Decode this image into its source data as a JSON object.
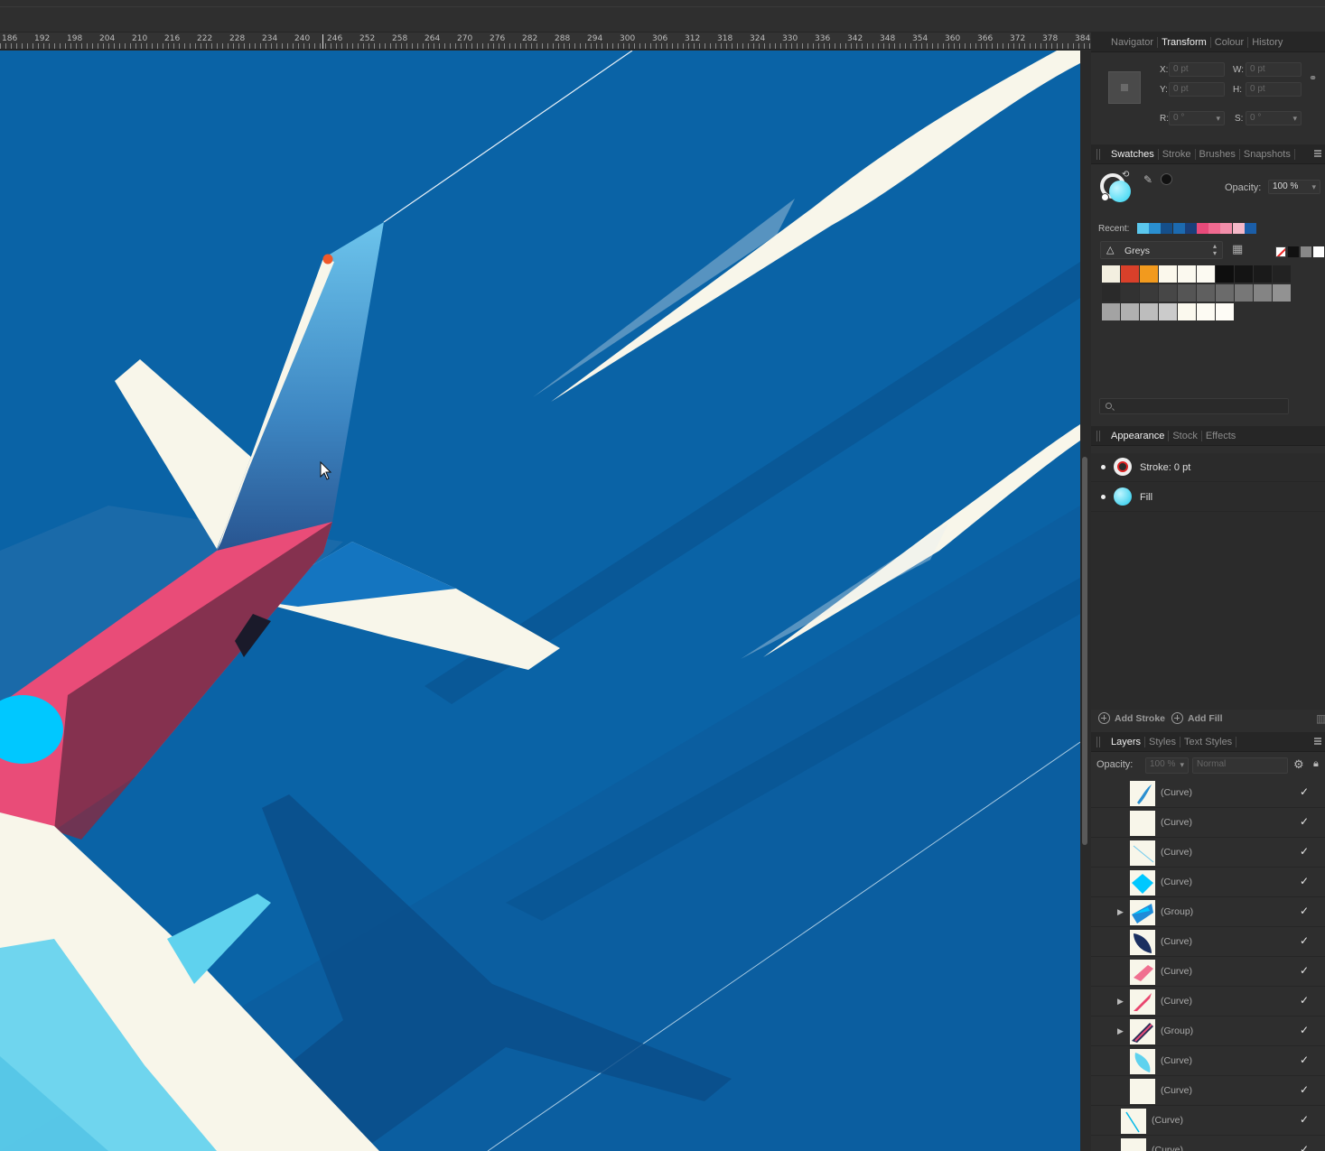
{
  "ruler": {
    "labels": [
      "186",
      "192",
      "198",
      "204",
      "210",
      "216",
      "222",
      "228",
      "234",
      "240",
      "246",
      "252",
      "258",
      "264",
      "270",
      "276",
      "282",
      "288",
      "294",
      "300",
      "306",
      "312",
      "318",
      "324",
      "330",
      "336",
      "342",
      "348",
      "354",
      "360",
      "366",
      "372",
      "378",
      "384"
    ]
  },
  "transform_panel": {
    "tabs": [
      "Navigator",
      "Transform",
      "Colour",
      "History"
    ],
    "active_tab": "Transform",
    "x_label": "X:",
    "x_value": "0 pt",
    "y_label": "Y:",
    "y_value": "0 pt",
    "w_label": "W:",
    "w_value": "0 pt",
    "h_label": "H:",
    "h_value": "0 pt",
    "r_label": "R:",
    "r_value": "0 °",
    "s_label": "S:",
    "s_value": "0 °",
    "link_icon": "link-icon"
  },
  "swatches_panel": {
    "tabs": [
      "Swatches",
      "Stroke",
      "Brushes",
      "Snapshots"
    ],
    "active_tab": "Swatches",
    "opacity_label": "Opacity:",
    "opacity_value": "100 %",
    "recent_label": "Recent:",
    "recent_colors": [
      "#5bc8ee",
      "#2a8fd0",
      "#154f8a",
      "#1c6ab0",
      "#1a3f7a",
      "#e84a7a",
      "#f06a90",
      "#f28eaa",
      "#f5b8c8",
      "#1b5ea8"
    ],
    "palette_name": "Greys",
    "palette_rows": [
      [
        "#f3efe0",
        "#d9402a",
        "#f29a1e",
        "#fbf8ec",
        "#fbf9ef",
        "#fcfaf2",
        "#0e0e0e",
        "#141414",
        "#1a1a1a",
        "#222222"
      ],
      [
        "#2a2a2a",
        "#323232",
        "#3a3a3a",
        "#474747",
        "#555555",
        "#5f5f5f",
        "#6b6b6b",
        "#777777",
        "#848484",
        "#929292"
      ],
      [
        "#a3a3a3",
        "#b0b0b0",
        "#bdbdbd",
        "#cbcbcb",
        "#fbf9ee",
        "#fdfbf3",
        "#fefcf6"
      ]
    ]
  },
  "appearance_panel": {
    "tabs": [
      "Appearance",
      "Stock",
      "Effects"
    ],
    "active_tab": "Appearance",
    "stroke_label": "Stroke: 0 pt",
    "fill_label": "Fill",
    "add_stroke": "Add Stroke",
    "add_fill": "Add Fill"
  },
  "layers_panel": {
    "tabs": [
      "Layers",
      "Styles",
      "Text Styles"
    ],
    "active_tab": "Layers",
    "opacity_label": "Opacity:",
    "opacity_value": "100 %",
    "blend_mode": "Normal",
    "rows": [
      {
        "name": "(Curve)",
        "thumb": "blue-stroke",
        "expand": false,
        "indent": 1
      },
      {
        "name": "(Curve)",
        "thumb": "cream",
        "expand": false,
        "indent": 1
      },
      {
        "name": "(Curve)",
        "thumb": "thin-line",
        "expand": false,
        "indent": 1
      },
      {
        "name": "(Curve)",
        "thumb": "cyan-diamond",
        "expand": false,
        "indent": 1
      },
      {
        "name": "(Group)",
        "thumb": "blue-wing",
        "expand": true,
        "indent": 1
      },
      {
        "name": "(Curve)",
        "thumb": "navy-leaf",
        "expand": false,
        "indent": 1
      },
      {
        "name": "(Curve)",
        "thumb": "pink-blob",
        "expand": false,
        "indent": 1
      },
      {
        "name": "(Curve)",
        "thumb": "pink-stroke",
        "expand": true,
        "indent": 1
      },
      {
        "name": "(Group)",
        "thumb": "navy-pink",
        "expand": true,
        "indent": 1
      },
      {
        "name": "(Curve)",
        "thumb": "cyan-leaf",
        "expand": false,
        "indent": 1
      },
      {
        "name": "(Curve)",
        "thumb": "cream",
        "expand": false,
        "indent": 1
      },
      {
        "name": "(Curve)",
        "thumb": "cyan-line",
        "expand": false,
        "indent": 0
      },
      {
        "name": "(Curve)",
        "thumb": "cream",
        "expand": false,
        "indent": 0
      }
    ]
  }
}
